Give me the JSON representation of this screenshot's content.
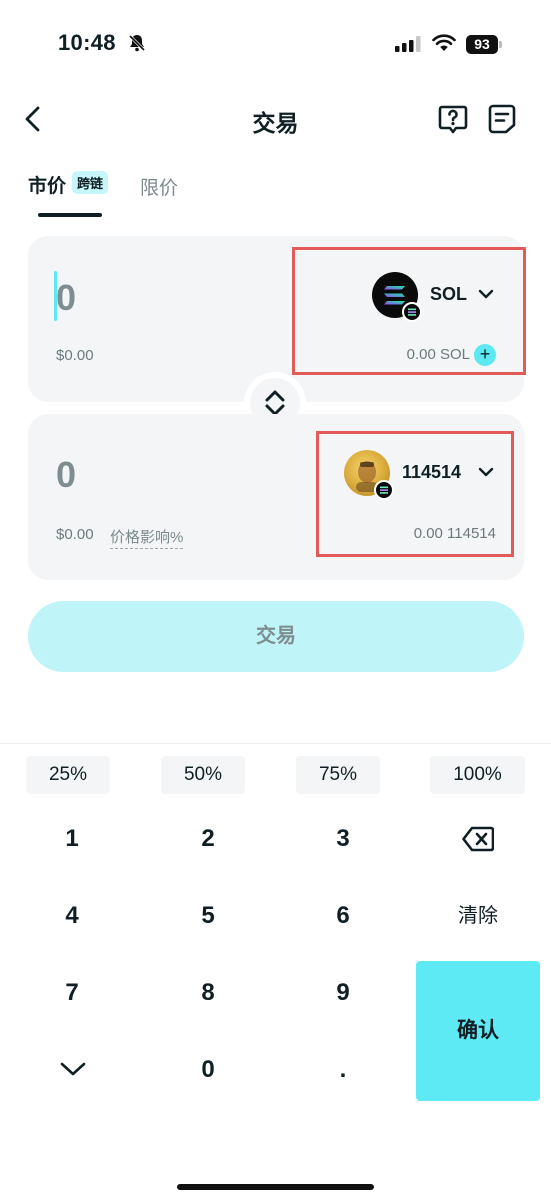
{
  "status_bar": {
    "time": "10:48",
    "battery": "93"
  },
  "header": {
    "title": "交易"
  },
  "tabs": {
    "market": "市价",
    "cross_chain_badge": "跨链",
    "limit": "限价"
  },
  "from": {
    "amount": "0",
    "usd_value": "$0.00",
    "token": "SOL",
    "balance": "0.00 SOL"
  },
  "to": {
    "amount": "0",
    "usd_value": "$0.00",
    "price_impact_label": "价格影响%",
    "token": "114514",
    "balance": "0.00 114514"
  },
  "trade_button": "交易",
  "percent_options": [
    "25%",
    "50%",
    "75%",
    "100%"
  ],
  "keypad": {
    "k1": "1",
    "k2": "2",
    "k3": "3",
    "k4": "4",
    "k5": "5",
    "k6": "6",
    "k7": "7",
    "k8": "8",
    "k9": "9",
    "k0": "0",
    "dot": ".",
    "clear": "清除",
    "confirm": "确认"
  },
  "colors": {
    "accent": "#5eeaf4",
    "accent_light": "#bff4f8",
    "card_bg": "#f4f5f6",
    "highlight": "#e35a5a",
    "text": "#0f1f24"
  }
}
